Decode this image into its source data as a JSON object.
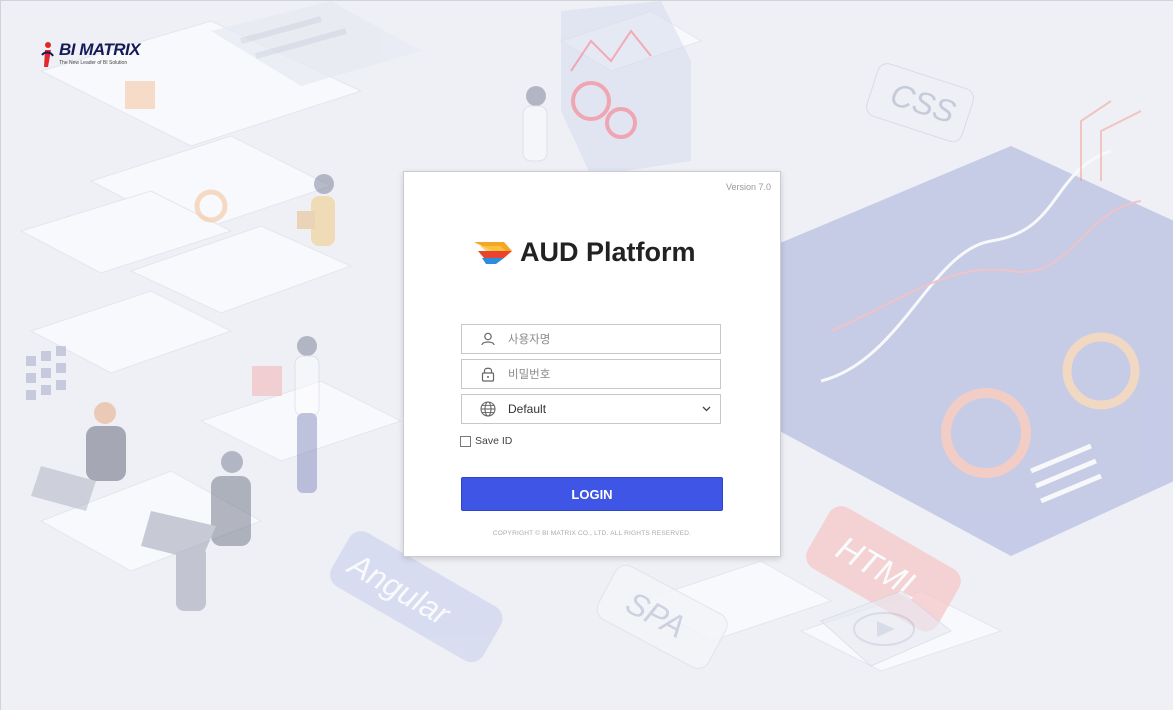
{
  "brand": {
    "company_name": "BI MATRIX",
    "company_tagline": "The New Leader of BI Solution"
  },
  "login_card": {
    "version": "Version 7.0",
    "product_title": "AUD Platform",
    "username_placeholder": "사용자명",
    "password_placeholder": "비밀번호",
    "language_selected": "Default",
    "save_id_label": "Save ID",
    "login_label": "LOGIN",
    "copyright": "COPYRIGHT © BI MATRIX CO., LTD. ALL RIGHTS RESERVED."
  },
  "background_tags": [
    "CSS",
    "HTML",
    "Angular",
    "SPA"
  ],
  "icons": [
    "user-icon",
    "lock-icon",
    "globe-icon",
    "chevron-down-icon",
    "aud-logo-icon",
    "bi-matrix-logo-icon"
  ],
  "colors": {
    "login_button": "#3f55e6",
    "brand_navy": "#151a56",
    "accent_red": "#e2262b"
  }
}
